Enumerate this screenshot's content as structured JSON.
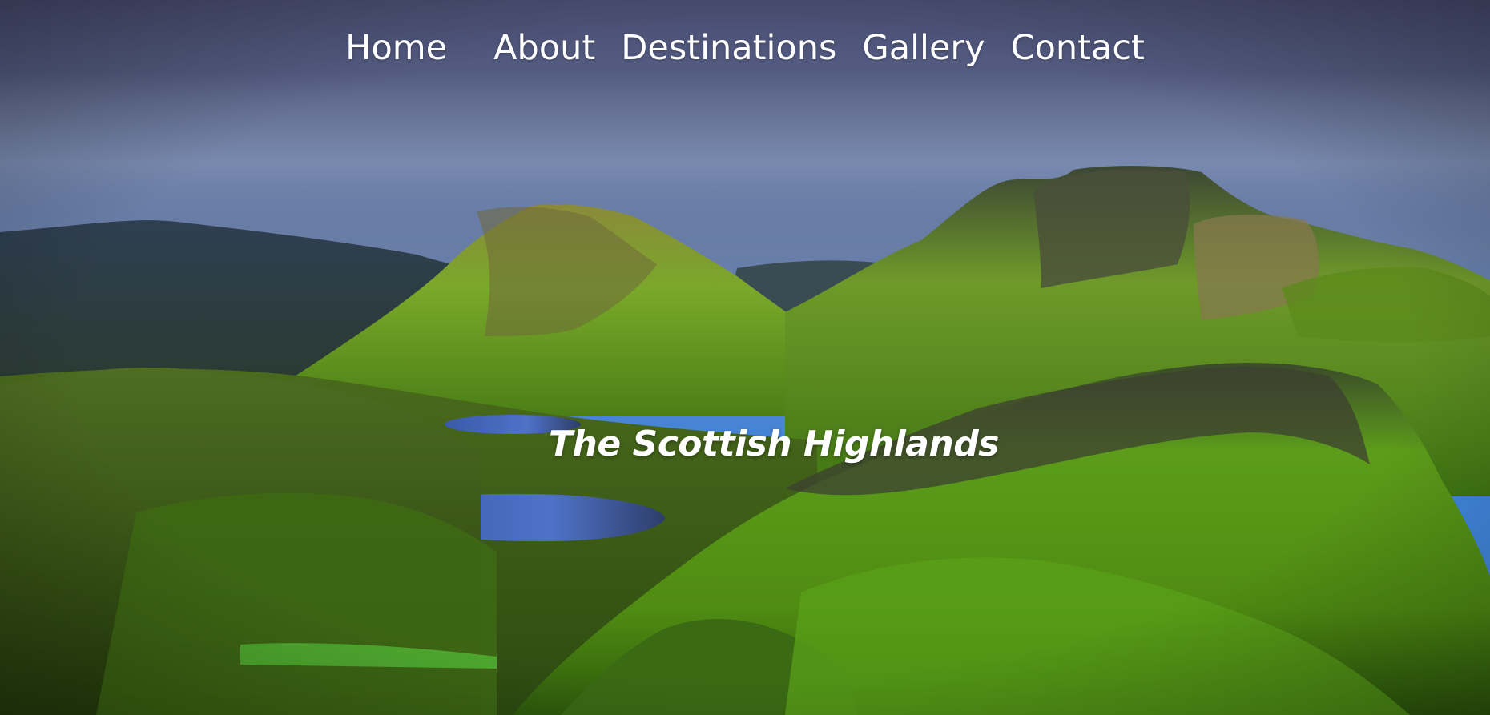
{
  "nav": {
    "items": [
      {
        "label": "Home"
      },
      {
        "label": "About"
      },
      {
        "label": "Destinations"
      },
      {
        "label": "Gallery"
      },
      {
        "label": "Contact"
      }
    ]
  },
  "hero": {
    "title": "The Scottish Highlands",
    "background_image": "scottish-highlands-landscape"
  },
  "colors": {
    "nav_text": "#ffffff",
    "title_text": "#ffffff",
    "sky": "#4f88d8",
    "grass": "#5a9a18"
  }
}
